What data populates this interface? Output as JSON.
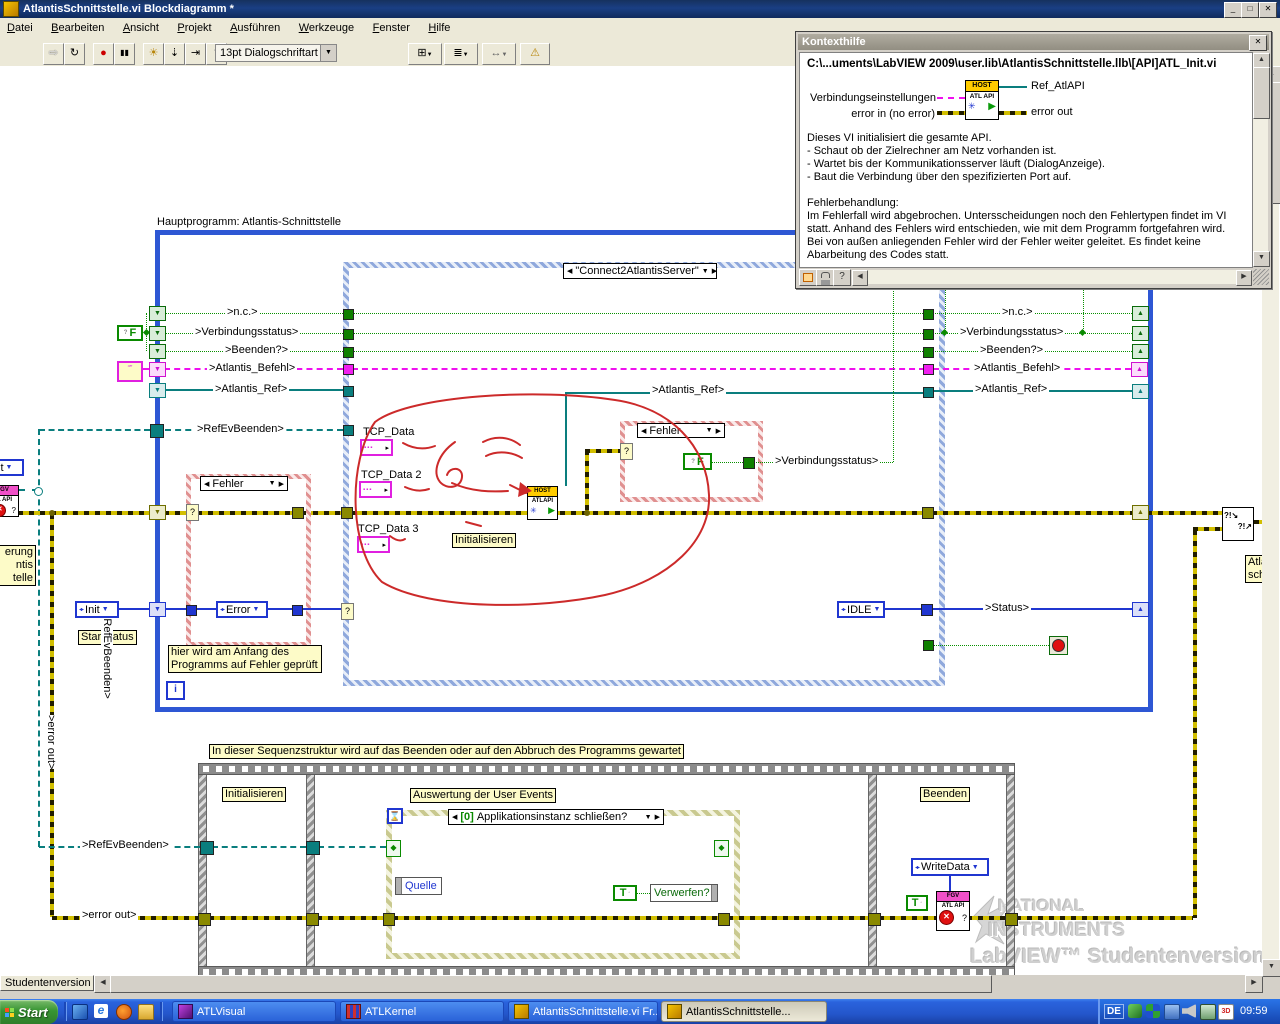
{
  "titlebar": {
    "title": "AtlantisSchnittstelle.vi Blockdiagramm *"
  },
  "menu": {
    "items": [
      "Datei",
      "Bearbeiten",
      "Ansicht",
      "Projekt",
      "Ausführen",
      "Werkzeuge",
      "Fenster",
      "Hilfe"
    ]
  },
  "toolbar": {
    "font": "13pt Dialogschriftart"
  },
  "icons": {
    "run": "⇨",
    "run_continuous": "↻",
    "abort": "●",
    "pause": "▮▮",
    "highlight_execution": "☀",
    "step_into": "⇣",
    "step_over": "⇥",
    "step_out": "⇡",
    "align_objects": "⊞",
    "distribute_objects": "≣",
    "resize_objects": "↔",
    "cleanup_diagram": "⚠",
    "dropdown": "▼",
    "case_prev": "◀",
    "case_next": "▶",
    "sr_down": "▼",
    "sr_up": "▲",
    "enum_pair": "◂▸",
    "minimize": "_",
    "maximize": "□",
    "close": "✕",
    "hourglass": "⌛",
    "vi_play": "▶",
    "vi_asterisk": "✳",
    "question": "?",
    "stop_round": "●",
    "scroll_left": "◀",
    "scroll_right": "▶",
    "scroll_up": "▲",
    "scroll_down": "▼",
    "merge_tl": "?!↘",
    "merge_br": "?!↗",
    "event_terminal": "◆"
  },
  "help": {
    "title": "Kontexthilfe",
    "path": "C:\\...uments\\LabVIEW 2009\\user.lib\\AtlantisSchnittstelle.llb\\[API]ATL_Init.vi",
    "in1": "Verbindungseinstellungen",
    "in2": "error in (no error)",
    "out1": "Ref_AtlAPI",
    "out2": "error out",
    "icon_top": "HOST",
    "icon_body": "ATL API",
    "lines": [
      "Dieses VI initialisiert die gesamte API.",
      "- Schaut ob der Zielrechner am Netz vorhanden ist.",
      "- Wartet bis der Kommunikationsserver läuft (DialogAnzeige).",
      "- Baut die Verbindung über den spezifizierten Port auf.",
      "Fehlerbehandlung:",
      "Im Fehlerfall wird abgebrochen. Untersscheidungen noch den Fehlertypen findet im VI statt. Anhand des Fehlers wird entschieden, wie mit dem Programm fortgefahren wird. Bei von außen anliegenden Fehler wird der Fehler weiter geleitet. Es findet keine Abarbeitung des Codes statt."
    ]
  },
  "loop": {
    "label": "Hauptprogramm: Atlantis-Schnittstelle",
    "iteration": "i"
  },
  "case_main": {
    "selector": "\"Connect2AtlantisServer\""
  },
  "wires": {
    "nc": ">n.c.>",
    "verbindungsstatus": ">Verbindungsstatus>",
    "beenden": ">Beenden?>",
    "befehl": ">Atlantis_Befehl>",
    "ref": ">Atlantis_Ref>",
    "refev": ">RefEvBeenden>",
    "status": ">Status>",
    "errout": ">error out>"
  },
  "fehler_case": {
    "selector": "Fehler"
  },
  "consts": {
    "init": "Init",
    "error": "Error",
    "idle": "IDLE",
    "writedata": "WriteData",
    "t": "T",
    "f": "F"
  },
  "labels": {
    "startstatus": "Startstatus",
    "fehler_comment": "hier wird am Anfang des Programms auf Fehler geprüft",
    "initialisieren": "Initialisieren",
    "tcp1": "TCP_Data",
    "tcp2": "TCP_Data 2",
    "tcp3": "TCP_Data 3",
    "seq_comment": "In dieser Sequenzstruktur wird auf das Beenden oder auf den Abbruch des Programms gewartet",
    "user_events": "Auswertung der User Events",
    "beenden": "Beenden",
    "quelle": "Quelle",
    "verwerfen": "Verwerfen?",
    "left_clip_1": "erung",
    "left_clip_2": "ntis",
    "left_clip_3": "telle",
    "left_clip_enum": "it",
    "right_clip_1": "Atla",
    "right_clip_2": "schl"
  },
  "event": {
    "index": "[0]",
    "name": "Applikationsinstanz schließen?"
  },
  "vi": {
    "host_top": "HOST",
    "host_body": "ATLAPI",
    "fgv_top": "FGV",
    "fgv_body": "ATL API",
    "gv_top": "GV",
    "gv_body": "L API"
  },
  "watermark": {
    "l1": "NATIONAL",
    "l2": "INSTRUMENTS",
    "l3": "LabVIEW™ Studentenversion"
  },
  "statusbar": {
    "tab": "Studentenversion"
  },
  "taskbar": {
    "start": "Start",
    "tasks": [
      {
        "label": "ATLVisual"
      },
      {
        "label": "ATLKernel"
      },
      {
        "label": "AtlantisSchnittstelle.vi Fr..."
      },
      {
        "label": "AtlantisSchnittstelle..."
      }
    ],
    "lang": "DE",
    "time": "09:59"
  },
  "colors": {
    "loop_border": "#2e57d4",
    "error_wire": "#d2bf00",
    "string_wire": "#ef10ef",
    "refnum_wire": "#0a7e7e",
    "bool_wire": "#089000",
    "enum_wire": "#2036d0",
    "case_hatch": "#8fa8dc",
    "fehler_hatch": "#e09090",
    "event_hatch": "#c9c98f",
    "taskbar_blue": "#2a63dd",
    "start_green": "#3c9638",
    "titlebar_blue": "#16315e"
  }
}
